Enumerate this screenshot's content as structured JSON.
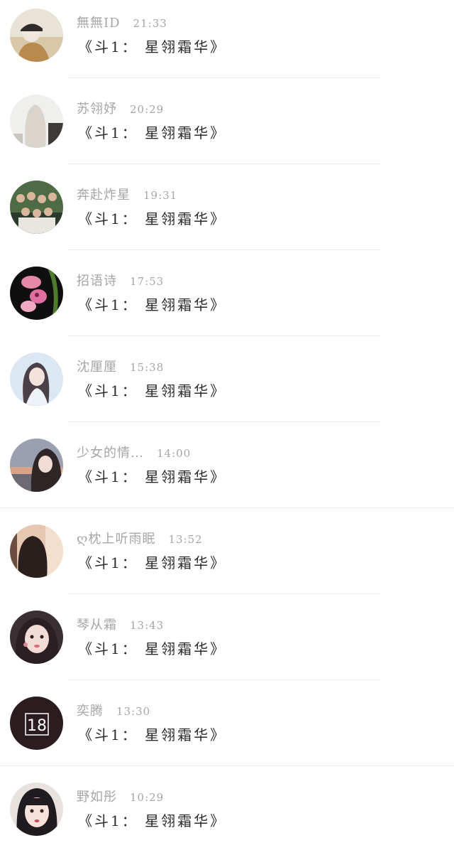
{
  "messages": [
    {
      "name": "無無ID",
      "time": "21:33",
      "text": "《斗1： 星翎霜华》",
      "avatar": "avatar-photo"
    },
    {
      "name": "苏翎妤",
      "time": "20:29",
      "text": "《斗1： 星翎霜华》",
      "avatar": "avatar-photo"
    },
    {
      "name": "奔赴炸星",
      "time": "19:31",
      "text": "《斗1： 星翎霜华》",
      "avatar": "avatar-photo"
    },
    {
      "name": "招语诗",
      "time": "17:53",
      "text": "《斗1： 星翎霜华》",
      "avatar": "avatar-photo"
    },
    {
      "name": "沈厘厘",
      "time": "15:38",
      "text": "《斗1： 星翎霜华》",
      "avatar": "avatar-photo"
    },
    {
      "name": "少女的情…",
      "time": "14:00",
      "text": "《斗1： 星翎霜华》",
      "avatar": "avatar-photo"
    },
    {
      "name": "ღ枕上听雨眠",
      "time": "13:52",
      "text": "《斗1： 星翎霜华》",
      "avatar": "avatar-photo"
    },
    {
      "name": "琴从霜",
      "time": "13:43",
      "text": "《斗1： 星翎霜华》",
      "avatar": "avatar-photo"
    },
    {
      "name": "奕腾",
      "time": "13:30",
      "text": "《斗1： 星翎霜华》",
      "avatar": "avatar-logo",
      "avatar_text": "18"
    },
    {
      "name": "野如彤",
      "time": "10:29",
      "text": "《斗1： 星翎霜华》",
      "avatar": "avatar-photo"
    }
  ],
  "colors": {
    "name": "#a6a6a6",
    "time": "#a6a6a6",
    "message": "#2a2a2a",
    "divider": "#eeeeee",
    "background": "#ffffff"
  }
}
